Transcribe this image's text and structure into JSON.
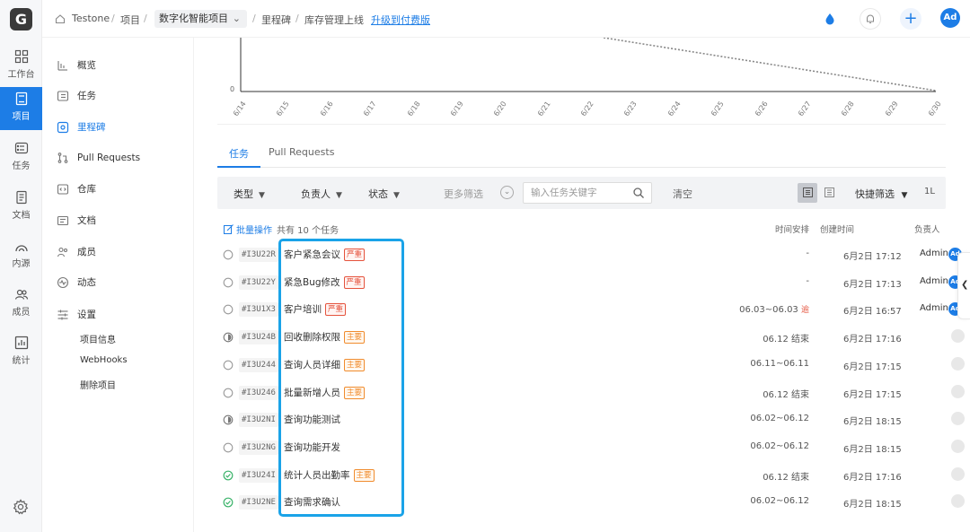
{
  "rail": {
    "logo": "G",
    "items": [
      {
        "label": "工作台",
        "icon": "grid-icon"
      },
      {
        "label": "项目",
        "icon": "book-icon"
      },
      {
        "label": "任务",
        "icon": "checklist-icon"
      },
      {
        "label": "文档",
        "icon": "document-icon"
      },
      {
        "label": "内源",
        "icon": "source-icon"
      },
      {
        "label": "成员",
        "icon": "members-icon"
      },
      {
        "label": "统计",
        "icon": "stats-icon"
      }
    ]
  },
  "header": {
    "org": "Testone",
    "sep": "/",
    "projects": "项目",
    "project_select": "数字化智能项目",
    "milestone": "里程碑",
    "milestone_name": "库存管理上线",
    "upgrade": "升级到付费版",
    "avatar": "Ad"
  },
  "subnav": {
    "items": [
      {
        "label": "概览",
        "icon": "bar-chart-icon"
      },
      {
        "label": "任务",
        "icon": "task-icon"
      },
      {
        "label": "里程碑",
        "icon": "milestone-icon"
      },
      {
        "label": "Pull Requests",
        "icon": "pull-request-icon"
      },
      {
        "label": "仓库",
        "icon": "repo-icon"
      },
      {
        "label": "文档",
        "icon": "doc-icon"
      },
      {
        "label": "成员",
        "icon": "member-icon"
      },
      {
        "label": "动态",
        "icon": "activity-icon"
      },
      {
        "label": "设置",
        "icon": "settings-sliders-icon"
      }
    ],
    "settings_sub": [
      "项目信息",
      "WebHooks",
      "删除项目"
    ]
  },
  "chart": {
    "y_zero": "0",
    "ticks": [
      "6/14",
      "6/15",
      "6/16",
      "6/17",
      "6/18",
      "6/19",
      "6/20",
      "6/21",
      "6/22",
      "6/23",
      "6/24",
      "6/25",
      "6/26",
      "6/27",
      "6/28",
      "6/29",
      "6/30"
    ]
  },
  "tabs": [
    "任务",
    "Pull Requests"
  ],
  "filter": {
    "type": "类型",
    "assignee": "负责人",
    "status": "状态",
    "more": "更多筛选",
    "search_placeholder": "输入任务关键字",
    "clear": "清空",
    "quick": "快捷筛选",
    "sort": "1L"
  },
  "list": {
    "batch": "批量操作",
    "count": "共有 10 个任务",
    "col_schedule": "时间安排",
    "col_created": "创建时间",
    "col_assignee": "负责人",
    "rows": [
      {
        "status": "todo",
        "code": "#I3U22R",
        "title": "客户紧急会议",
        "tag": "严重",
        "tag_type": "severe",
        "schedule": "-",
        "overdue": "",
        "created": "6月2日 17:12",
        "assignee": "Admin",
        "avatar": "Ad"
      },
      {
        "status": "todo",
        "code": "#I3U22Y",
        "title": "紧急Bug修改",
        "tag": "严重",
        "tag_type": "severe",
        "schedule": "-",
        "overdue": "",
        "created": "6月2日 17:13",
        "assignee": "Admin",
        "avatar": "Ad"
      },
      {
        "status": "todo",
        "code": "#I3U1X3",
        "title": "客户培训",
        "tag": "严重",
        "tag_type": "severe",
        "schedule": "06.03~06.03",
        "overdue": "逾",
        "created": "6月2日 16:57",
        "assignee": "Admin",
        "avatar": "Ad"
      },
      {
        "status": "progress",
        "code": "#I3U24B",
        "title": "回收删除权限",
        "tag": "主要",
        "tag_type": "major",
        "schedule": "06.12 结束",
        "overdue": "",
        "created": "6月2日 17:16",
        "assignee": "",
        "avatar": ""
      },
      {
        "status": "todo",
        "code": "#I3U244",
        "title": "查询人员详细",
        "tag": "主要",
        "tag_type": "major",
        "schedule": "06.11~06.11",
        "overdue": "",
        "created": "6月2日 17:15",
        "assignee": "",
        "avatar": ""
      },
      {
        "status": "todo",
        "code": "#I3U246",
        "title": "批量新增人员",
        "tag": "主要",
        "tag_type": "major",
        "schedule": "06.12 结束",
        "overdue": "",
        "created": "6月2日 17:15",
        "assignee": "",
        "avatar": ""
      },
      {
        "status": "progress",
        "code": "#I3U2NI",
        "title": "查询功能测试",
        "tag": "",
        "tag_type": "",
        "schedule": "06.02~06.12",
        "overdue": "",
        "created": "6月2日 18:15",
        "assignee": "",
        "avatar": ""
      },
      {
        "status": "todo",
        "code": "#I3U2NG",
        "title": "查询功能开发",
        "tag": "",
        "tag_type": "",
        "schedule": "06.02~06.12",
        "overdue": "",
        "created": "6月2日 18:15",
        "assignee": "",
        "avatar": ""
      },
      {
        "status": "done",
        "code": "#I3U24I",
        "title": "统计人员出勤率",
        "tag": "主要",
        "tag_type": "major",
        "schedule": "06.12 结束",
        "overdue": "",
        "created": "6月2日 17:16",
        "assignee": "",
        "avatar": ""
      },
      {
        "status": "done",
        "code": "#I3U2NE",
        "title": "查询需求确认",
        "tag": "",
        "tag_type": "",
        "schedule": "06.02~06.12",
        "overdue": "",
        "created": "6月2日 18:15",
        "assignee": "",
        "avatar": ""
      }
    ]
  },
  "colors": {
    "accent": "#1d7de6",
    "severe": "#e5533d",
    "major": "#f08c2e",
    "done": "#3bb36a",
    "highlight": "#1aa3e8"
  }
}
